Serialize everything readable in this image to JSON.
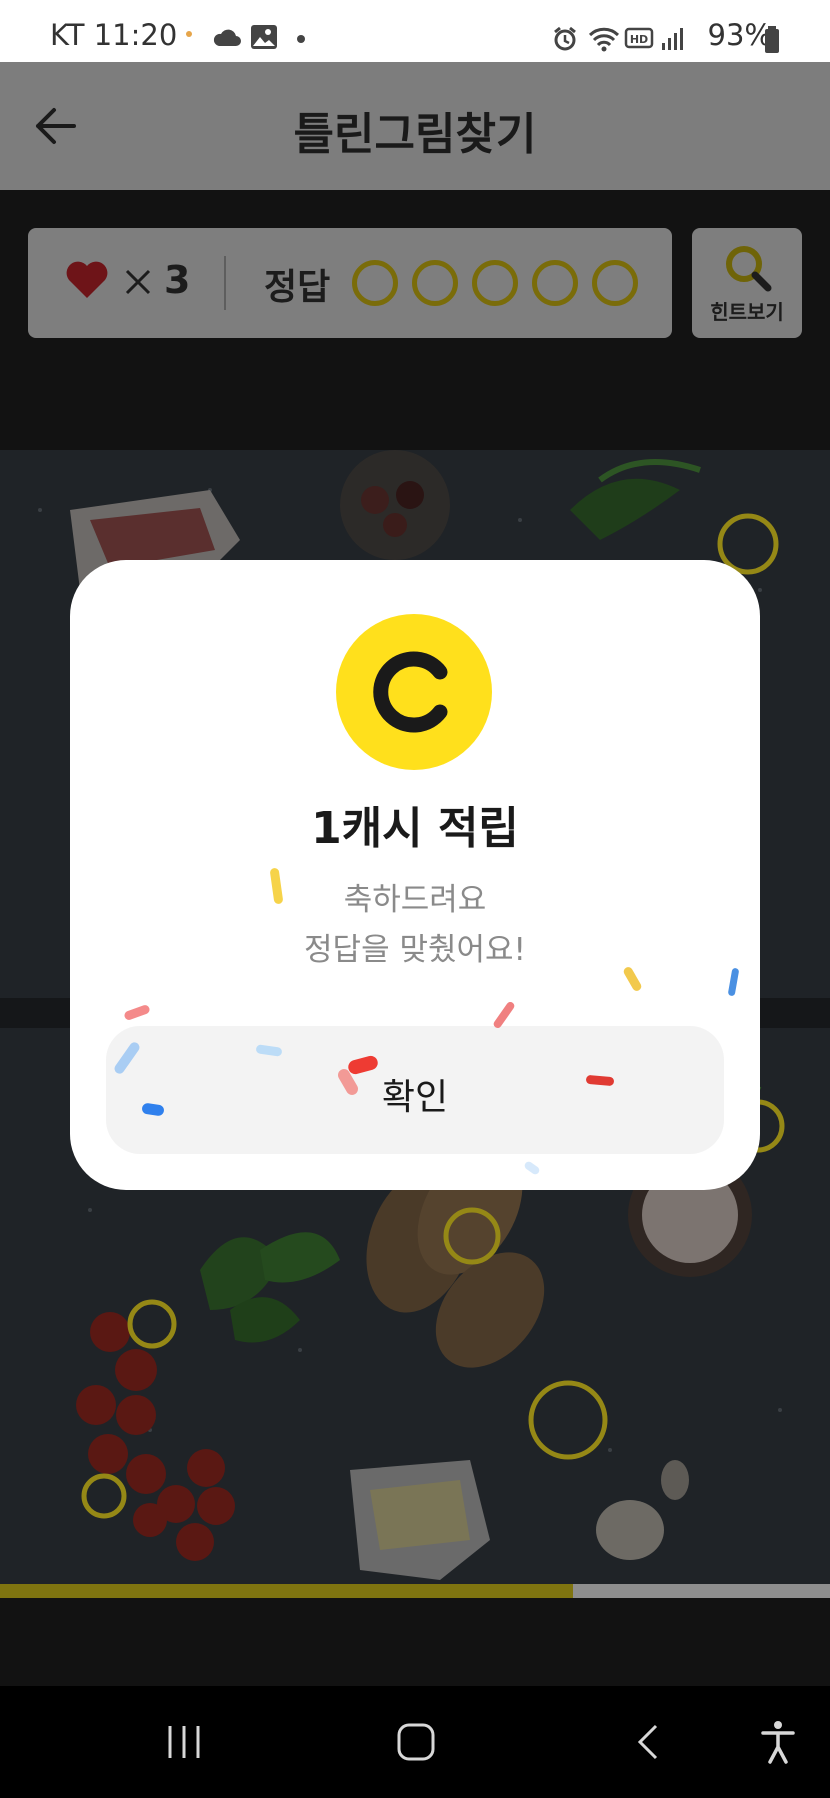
{
  "status_bar": {
    "time": "KT 11:20",
    "battery": "93%"
  },
  "header": {
    "title": "틀린그림찾기"
  },
  "game_info": {
    "lives_count": "3",
    "answer_label": "정답",
    "answers_total": 5,
    "answers_found": 0,
    "hint_label": "힌트보기"
  },
  "progress": {
    "fraction": 0.69
  },
  "modal": {
    "title": "1캐시 적립",
    "message_line1": "축하드려요",
    "message_line2": "정답을 맞췄어요!",
    "confirm_label": "확인",
    "coin_letter": "C"
  },
  "colors": {
    "coin_yellow": "#ffe01c",
    "ring_gold": "#958816",
    "progress_fill": "#7f7410"
  }
}
